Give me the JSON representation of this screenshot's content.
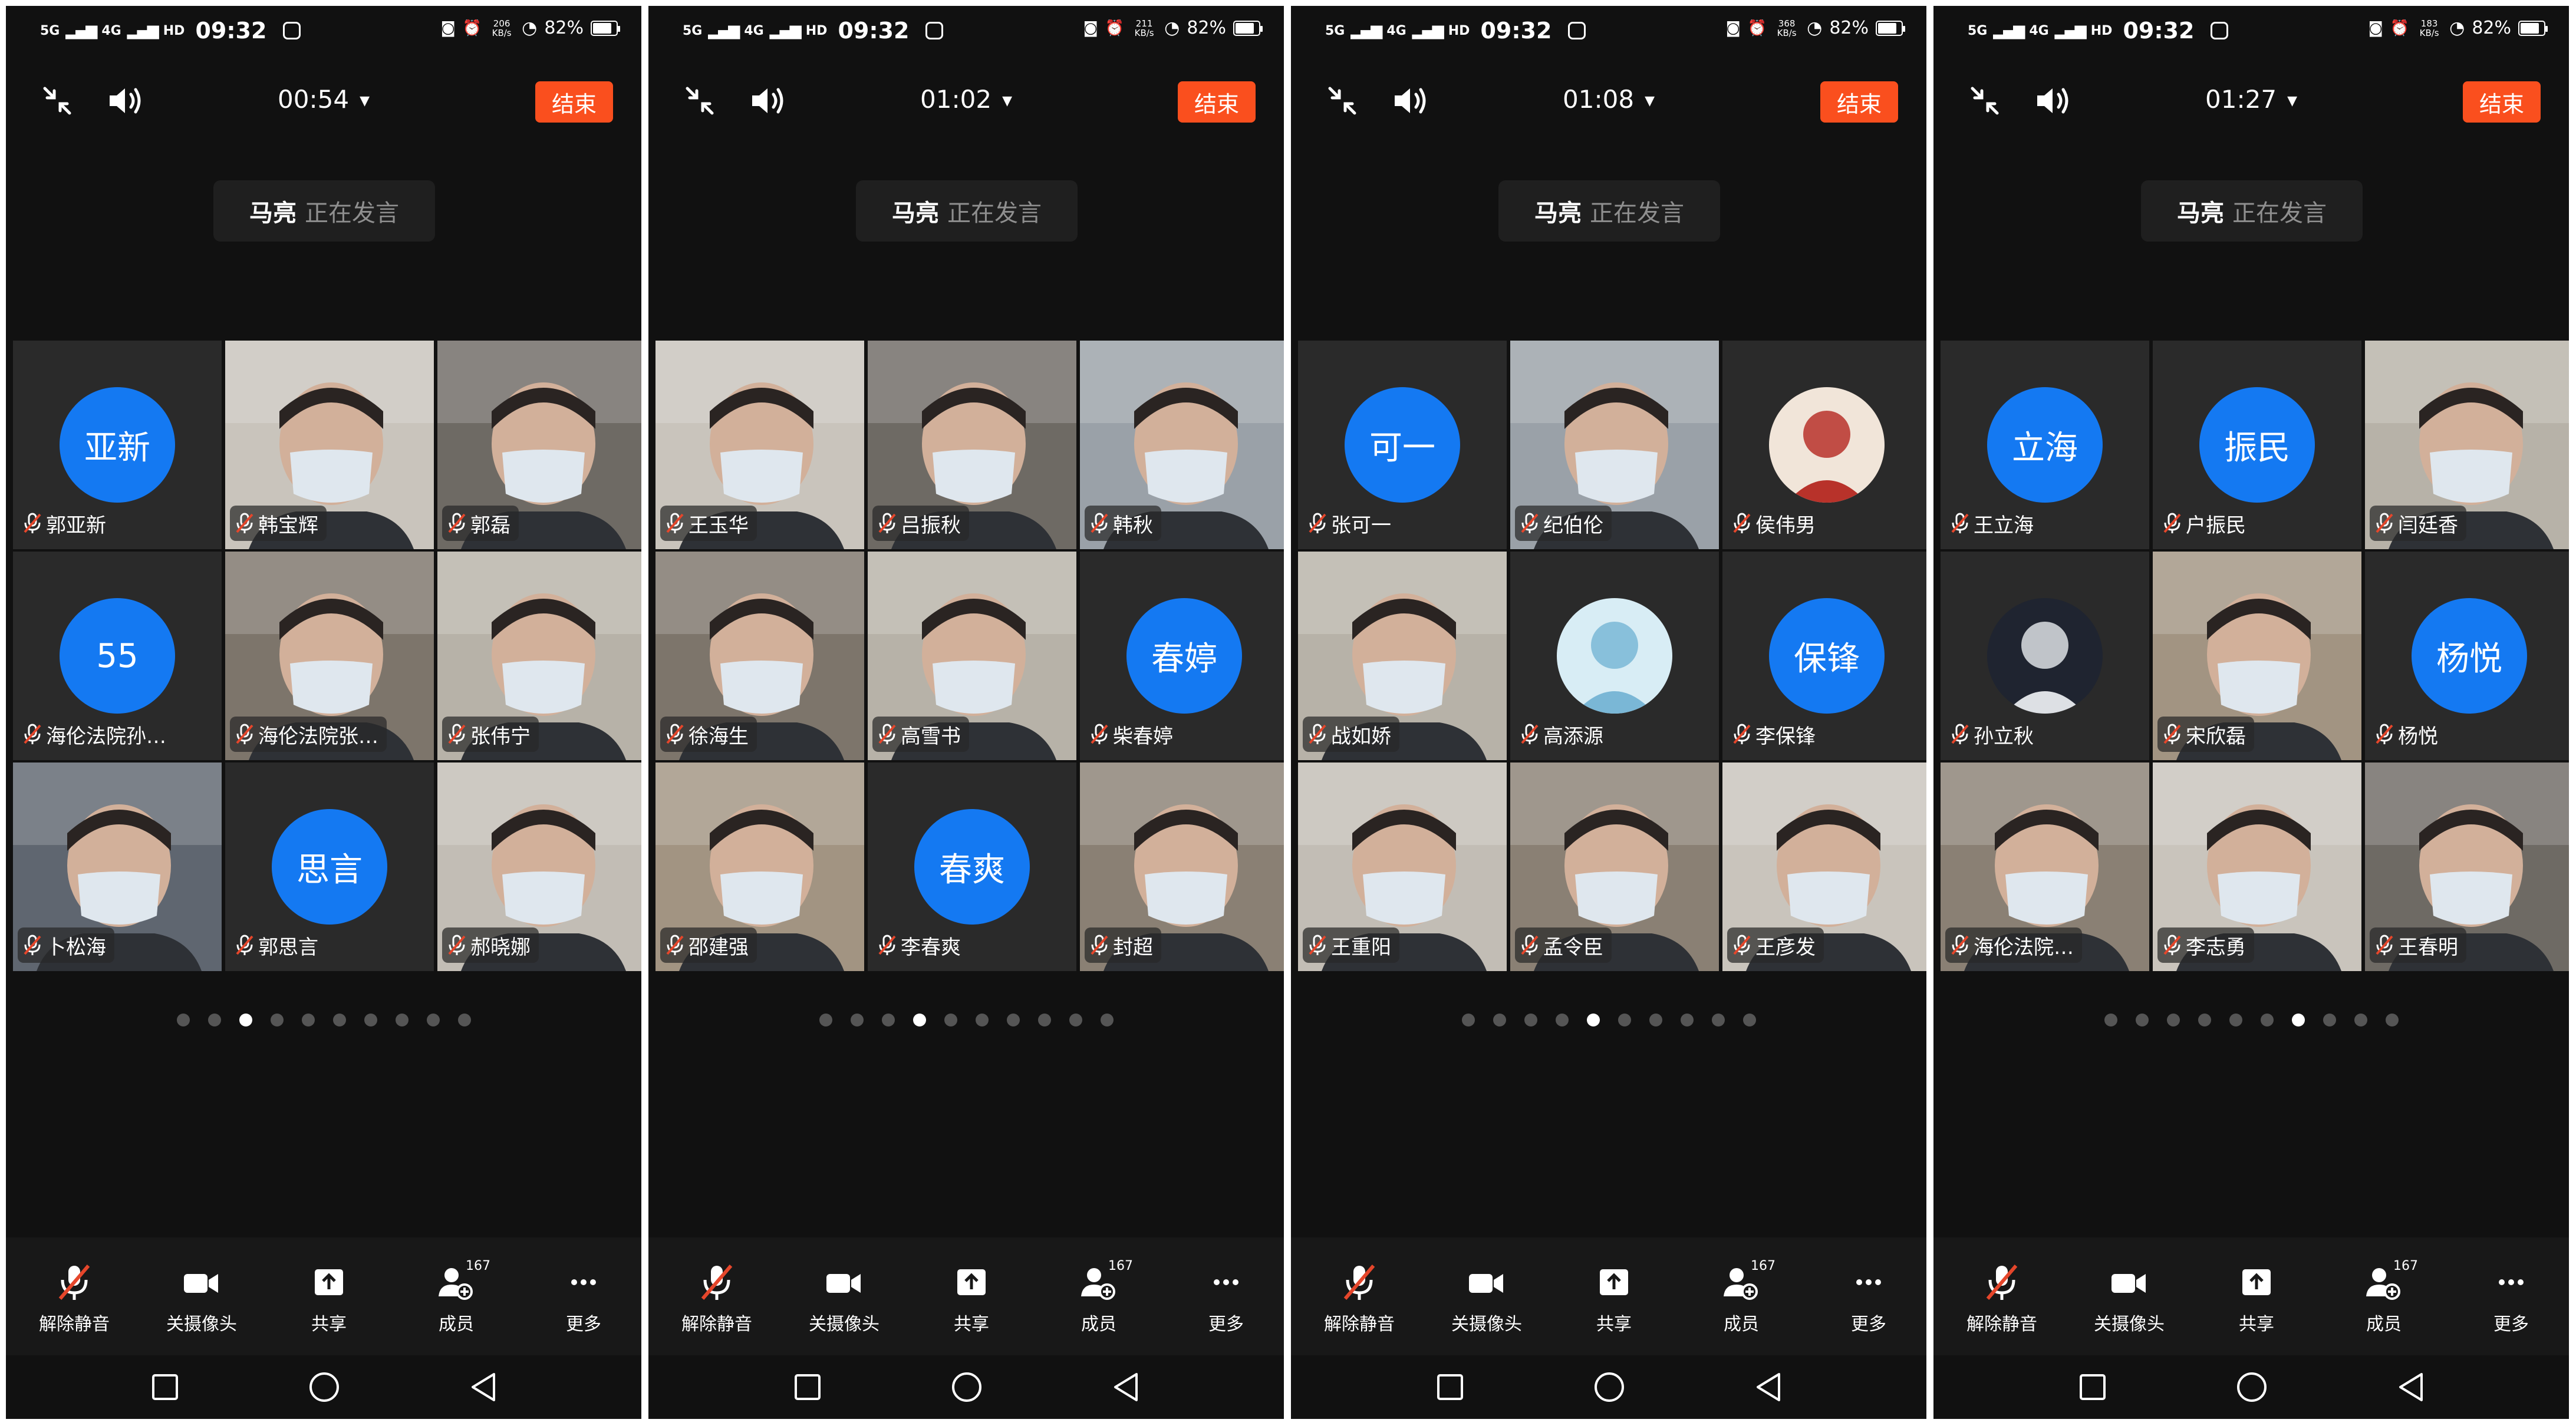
{
  "status": {
    "network": "5G",
    "network2": "4G",
    "hd": "HD",
    "time": "09:32",
    "battery": "82%",
    "battery_level": 0.82
  },
  "end_label": "结束",
  "speaking": {
    "name": "马亮",
    "status": "正在发言"
  },
  "toolbar": {
    "unmute": "解除静音",
    "camera_off": "关摄像头",
    "share": "共享",
    "members": "成员",
    "members_count": "167",
    "more": "更多"
  },
  "colors": {
    "accent": "#fa4f1e",
    "avatar_blue": "#1479f2",
    "mic_red": "#e5462b"
  },
  "panels": [
    {
      "net_speed": "206",
      "net_unit": "KB/s",
      "timer": "00:54",
      "active_page": 3,
      "page_count": 10,
      "tiles": [
        {
          "type": "avatar",
          "avatar": "亚新",
          "name": "郭亚新"
        },
        {
          "type": "video",
          "name": "韩宝辉"
        },
        {
          "type": "video",
          "name": "郭磊"
        },
        {
          "type": "avatar",
          "avatar": "55",
          "name": "海伦法院孙…"
        },
        {
          "type": "video",
          "name": "海伦法院张…"
        },
        {
          "type": "video",
          "name": "张伟宁"
        },
        {
          "type": "video",
          "name": "卜松海"
        },
        {
          "type": "avatar",
          "avatar": "思言",
          "name": "郭思言"
        },
        {
          "type": "video",
          "name": "郝晓娜"
        }
      ]
    },
    {
      "net_speed": "211",
      "net_unit": "KB/s",
      "timer": "01:02",
      "active_page": 4,
      "page_count": 10,
      "tiles": [
        {
          "type": "video",
          "name": "王玉华"
        },
        {
          "type": "video",
          "name": "吕振秋"
        },
        {
          "type": "video",
          "name": "韩秋"
        },
        {
          "type": "video",
          "name": "徐海生"
        },
        {
          "type": "video",
          "name": "高雪书"
        },
        {
          "type": "avatar",
          "avatar": "春婷",
          "name": "柴春婷"
        },
        {
          "type": "video",
          "name": "邵建强"
        },
        {
          "type": "avatar",
          "avatar": "春爽",
          "name": "李春爽"
        },
        {
          "type": "video",
          "name": "封超"
        }
      ]
    },
    {
      "net_speed": "368",
      "net_unit": "KB/s",
      "timer": "01:08",
      "active_page": 5,
      "page_count": 10,
      "tiles": [
        {
          "type": "avatar",
          "avatar": "可一",
          "name": "张可一"
        },
        {
          "type": "video",
          "name": "纪伯伦"
        },
        {
          "type": "photo",
          "name": "侯伟男"
        },
        {
          "type": "video",
          "name": "战如娇"
        },
        {
          "type": "photo",
          "name": "高添源"
        },
        {
          "type": "avatar",
          "avatar": "保锋",
          "name": "李保锋"
        },
        {
          "type": "video",
          "name": "王重阳"
        },
        {
          "type": "video",
          "name": "孟令臣"
        },
        {
          "type": "video",
          "name": "王彦发"
        }
      ]
    },
    {
      "net_speed": "183",
      "net_unit": "KB/s",
      "timer": "01:27",
      "active_page": 7,
      "page_count": 10,
      "tiles": [
        {
          "type": "avatar",
          "avatar": "立海",
          "name": "王立海"
        },
        {
          "type": "avatar",
          "avatar": "振民",
          "name": "户振民"
        },
        {
          "type": "video",
          "name": "闫廷香"
        },
        {
          "type": "photo",
          "name": "孙立秋"
        },
        {
          "type": "video",
          "name": "宋欣磊"
        },
        {
          "type": "avatar",
          "avatar": "杨悦",
          "name": "杨悦"
        },
        {
          "type": "video",
          "name": "海伦法院…"
        },
        {
          "type": "video",
          "name": "李志勇"
        },
        {
          "type": "video",
          "name": "王春明"
        }
      ]
    }
  ]
}
